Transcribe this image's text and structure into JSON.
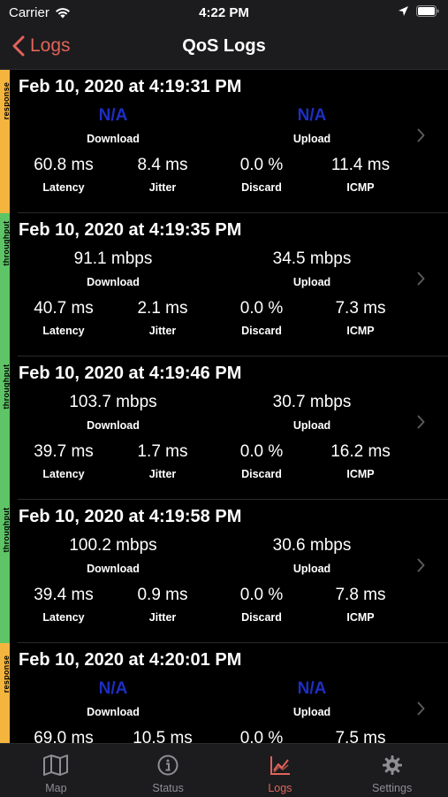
{
  "status_bar": {
    "carrier": "Carrier",
    "time": "4:22 PM"
  },
  "nav": {
    "back_label": "Logs",
    "title": "QoS Logs"
  },
  "colors": {
    "response": "#f4b53e",
    "throughput": "#5ec466",
    "accent": "#e2635a",
    "na": "#1e2ec4"
  },
  "metric_labels": {
    "download": "Download",
    "upload": "Upload",
    "latency": "Latency",
    "jitter": "Jitter",
    "discard": "Discard",
    "icmp": "ICMP"
  },
  "logs": [
    {
      "type": "response",
      "date": "Feb 10, 2020 at 4:19:31 PM",
      "download": "N/A",
      "upload": "N/A",
      "latency": "60.8 ms",
      "jitter": "8.4 ms",
      "discard": "0.0 %",
      "icmp": "11.4 ms"
    },
    {
      "type": "throughput",
      "date": "Feb 10, 2020 at 4:19:35 PM",
      "download": "91.1 mbps",
      "upload": "34.5 mbps",
      "latency": "40.7 ms",
      "jitter": "2.1 ms",
      "discard": "0.0 %",
      "icmp": "7.3 ms"
    },
    {
      "type": "throughput",
      "date": "Feb 10, 2020 at 4:19:46 PM",
      "download": "103.7 mbps",
      "upload": "30.7 mbps",
      "latency": "39.7 ms",
      "jitter": "1.7 ms",
      "discard": "0.0 %",
      "icmp": "16.2 ms"
    },
    {
      "type": "throughput",
      "date": "Feb 10, 2020 at 4:19:58 PM",
      "download": "100.2 mbps",
      "upload": "30.6 mbps",
      "latency": "39.4 ms",
      "jitter": "0.9 ms",
      "discard": "0.0 %",
      "icmp": "7.8 ms"
    },
    {
      "type": "response",
      "date": "Feb 10, 2020 at 4:20:01 PM",
      "download": "N/A",
      "upload": "N/A",
      "latency": "69.0 ms",
      "jitter": "10.5 ms",
      "discard": "0.0 %",
      "icmp": "7.5 ms"
    }
  ],
  "tabs": [
    {
      "label": "Map",
      "icon": "map-icon",
      "active": false
    },
    {
      "label": "Status",
      "icon": "info-icon",
      "active": false
    },
    {
      "label": "Logs",
      "icon": "chart-icon",
      "active": true
    },
    {
      "label": "Settings",
      "icon": "gear-icon",
      "active": false
    }
  ]
}
